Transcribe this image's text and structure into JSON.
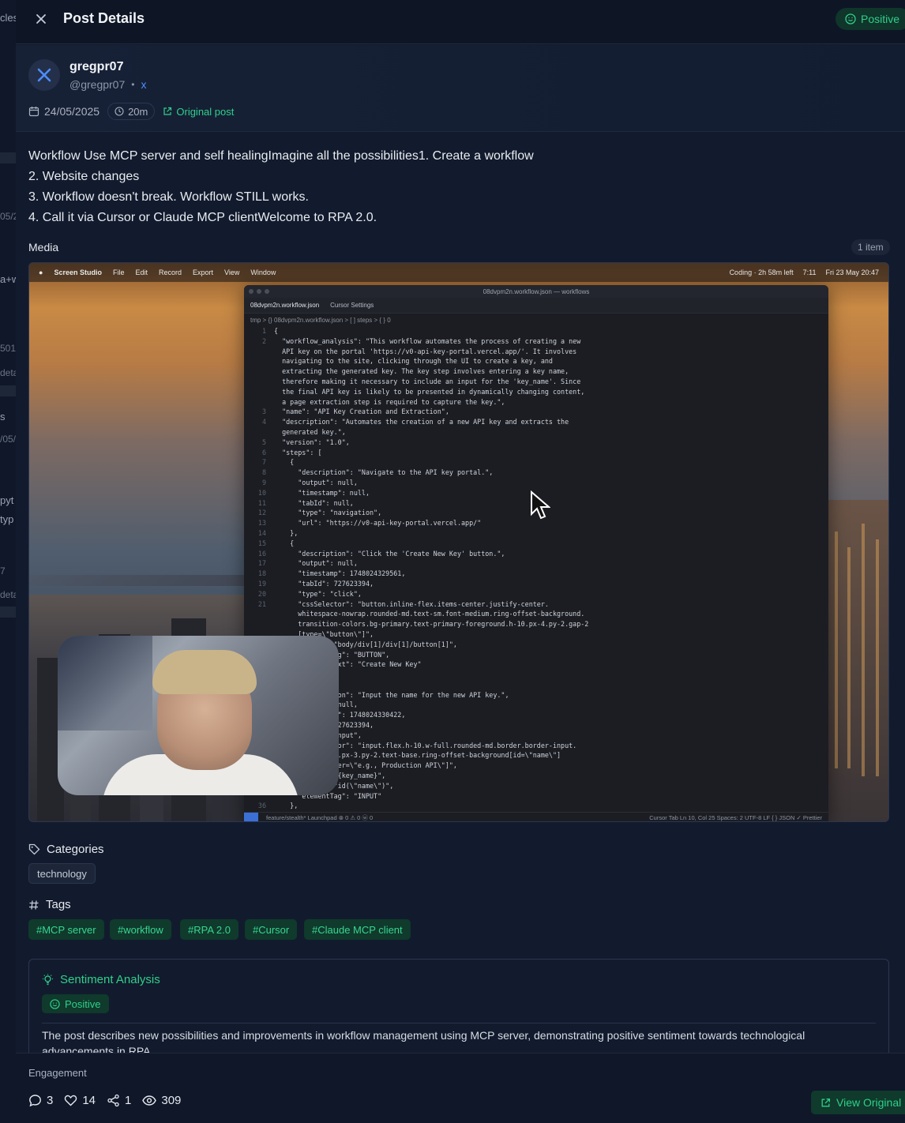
{
  "background_page": {
    "fragments": [
      "cles",
      "a+w",
      "05/2",
      "501",
      "deta",
      "s",
      "/05/",
      "pyt",
      "typ",
      "7",
      "deta"
    ]
  },
  "header": {
    "title": "Post Details",
    "sentiment_badge": "Positive"
  },
  "author": {
    "name": "gregpr07",
    "handle": "@gregpr07",
    "platform": "x",
    "date": "24/05/2025",
    "duration": "20m",
    "original_link": "Original post"
  },
  "post": {
    "lines": [
      "Workflow Use MCP server and self healingImagine all the possibilities1. Create a workflow",
      "2. Website changes",
      "3. Workflow doesn't break. Workflow STILL works.",
      "4. Call it via Cursor or Claude MCP clientWelcome to RPA 2.0."
    ]
  },
  "media": {
    "label": "Media",
    "count": "1 item",
    "screen": {
      "menubar_app": "Screen Studio",
      "menubar_items": [
        "File",
        "Edit",
        "Record",
        "Export",
        "View",
        "Window"
      ],
      "menubar_status": "Coding · 2h 58m left",
      "menubar_time": "7:11",
      "menubar_date": "Fri 23 May  20:47",
      "editor_title": "08dvpm2n.workflow.json — workflows",
      "tab_active": "08dvpm2n.workflow.json",
      "tab_other": "Cursor Settings",
      "breadcrumb": "tmp > {} 08dvpm2n.workflow.json > [ ] steps > { } 0",
      "code_lines": [
        {
          "n": "1",
          "t": "{"
        },
        {
          "n": "2",
          "t": "  \"workflow_analysis\": \"This workflow automates the process of creating a new"
        },
        {
          "n": "",
          "t": "  API key on the portal 'https://v0-api-key-portal.vercel.app/'. It involves"
        },
        {
          "n": "",
          "t": "  navigating to the site, clicking through the UI to create a key, and"
        },
        {
          "n": "",
          "t": "  extracting the generated key. The key step involves entering a key name,"
        },
        {
          "n": "",
          "t": "  therefore making it necessary to include an input for the 'key_name'. Since"
        },
        {
          "n": "",
          "t": "  the final API key is likely to be presented in dynamically changing content,"
        },
        {
          "n": "",
          "t": "  a page extraction step is required to capture the key.\","
        },
        {
          "n": "3",
          "t": "  \"name\": \"API Key Creation and Extraction\","
        },
        {
          "n": "4",
          "t": "  \"description\": \"Automates the creation of a new API key and extracts the"
        },
        {
          "n": "",
          "t": "  generated key.\","
        },
        {
          "n": "5",
          "t": "  \"version\": \"1.0\","
        },
        {
          "n": "6",
          "t": "  \"steps\": ["
        },
        {
          "n": "7",
          "t": "    {"
        },
        {
          "n": "8",
          "t": "      \"description\": \"Navigate to the API key portal.\","
        },
        {
          "n": "9",
          "t": "      \"output\": null,"
        },
        {
          "n": "10",
          "t": "      \"timestamp\": null,"
        },
        {
          "n": "11",
          "t": "      \"tabId\": null,"
        },
        {
          "n": "12",
          "t": "      \"type\": \"navigation\","
        },
        {
          "n": "13",
          "t": "      \"url\": \"https://v0-api-key-portal.vercel.app/\""
        },
        {
          "n": "14",
          "t": "    },"
        },
        {
          "n": "15",
          "t": "    {"
        },
        {
          "n": "16",
          "t": "      \"description\": \"Click the 'Create New Key' button.\","
        },
        {
          "n": "17",
          "t": "      \"output\": null,"
        },
        {
          "n": "18",
          "t": "      \"timestamp\": 1748024329561,"
        },
        {
          "n": "19",
          "t": "      \"tabId\": 727623394,"
        },
        {
          "n": "20",
          "t": "      \"type\": \"click\","
        },
        {
          "n": "21",
          "t": "      \"cssSelector\": \"button.inline-flex.items-center.justify-center."
        },
        {
          "n": "",
          "t": "      whitespace-nowrap.rounded-md.text-sm.font-medium.ring-offset-background."
        },
        {
          "n": "",
          "t": "      transition-colors.bg-primary.text-primary-foreground.h-10.px-4.py-2.gap-2"
        },
        {
          "n": "",
          "t": "      [type=\\\"button\\\"]\","
        },
        {
          "n": "",
          "t": "      \"xpath\": \"body/div[1]/div[1]/button[1]\","
        },
        {
          "n": "",
          "t": "      \"elementTag\": \"BUTTON\","
        },
        {
          "n": "",
          "t": "      \"elementText\": \"Create New Key\""
        },
        {
          "n": "",
          "t": ""
        },
        {
          "n": "",
          "t": ""
        },
        {
          "n": "",
          "t": "      \"description\": \"Input the name for the new API key.\","
        },
        {
          "n": "",
          "t": "      \"output\": null,"
        },
        {
          "n": "",
          "t": "      \"timestamp\": 1748024330422,"
        },
        {
          "n": "",
          "t": "      \"tabId\": 727623394,"
        },
        {
          "n": "",
          "t": "      \"type\": \"input\","
        },
        {
          "n": "",
          "t": "      \"cssSelector\": \"input.flex.h-10.w-full.rounded-md.border.border-input."
        },
        {
          "n": "",
          "t": "      background.px-3.py-2.text-base.ring-offset-background[id=\\\"name\\\"]"
        },
        {
          "n": "",
          "t": "      [placeholder=\\\"e.g., Production API\\\"]\","
        },
        {
          "n": "",
          "t": "      \"value\": \"{key_name}\","
        },
        {
          "n": "",
          "t": "      \"xpath\": \"id(\\\"name\\\")\","
        },
        {
          "n": "",
          "t": "      \"elementTag\": \"INPUT\""
        },
        {
          "n": "36",
          "t": "    },"
        }
      ],
      "status_left": "feature/stealth*      Launchpad   ⊗ 0 ⚠ 0   ⓦ 0",
      "status_right": "Cursor Tab   Ln 10, Col 25   Spaces: 2   UTF-8   LF   { } JSON   ✓ Prettier"
    }
  },
  "categories": {
    "heading": "Categories",
    "items": [
      "technology"
    ]
  },
  "tags": {
    "heading": "Tags",
    "items": [
      "#MCP server",
      "#workflow",
      "#RPA 2.0",
      "#Cursor",
      "#Claude MCP client"
    ]
  },
  "sentiment": {
    "title": "Sentiment Analysis",
    "label": "Positive",
    "text": "The post describes new possibilities and improvements in workflow management using MCP server, demonstrating positive sentiment towards technological advancements in RPA."
  },
  "engagement": {
    "label": "Engagement",
    "comments": "3",
    "likes": "14",
    "shares": "1",
    "views": "309",
    "view_button": "View Original"
  },
  "colors": {
    "accent": "#2fd08a",
    "background": "#121b2d",
    "tag_bg": "#0f3a2c",
    "platform": "#4c8dff"
  }
}
